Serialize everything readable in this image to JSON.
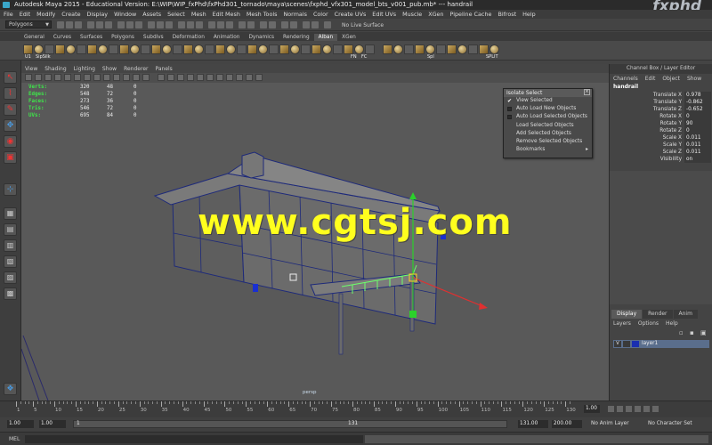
{
  "window": {
    "title": "Autodesk Maya 2015 - Educational Version: E:\\WIP\\WIP_fxPhd\\fxPhd301_tornado\\maya\\scenes\\fxphd_vfx301_model_bts_v001_pub.mb* --- handrail",
    "brand": "fxphd"
  },
  "menubar": [
    "File",
    "Edit",
    "Modify",
    "Create",
    "Display",
    "Window",
    "Assets",
    "Select",
    "Mesh",
    "Edit Mesh",
    "Mesh Tools",
    "Normals",
    "Color",
    "Create UVs",
    "Edit UVs",
    "Muscle",
    "XGen",
    "Pipeline Cache",
    "Bifrost",
    "Help"
  ],
  "statusline": {
    "mode": "Polygons",
    "live_surface": "No Live Surface"
  },
  "shelf": {
    "tabs": [
      "General",
      "Curves",
      "Surfaces",
      "Polygons",
      "Subdivs",
      "Deformation",
      "Animation",
      "Dynamics",
      "Rendering",
      "Alban",
      "XGen"
    ],
    "active_tab": "Alban",
    "labels": [
      "U1",
      "SipSilk",
      "FN",
      "FC",
      "Spl",
      "SPLIT"
    ]
  },
  "viewport": {
    "menu": [
      "View",
      "Shading",
      "Lighting",
      "Show",
      "Renderer",
      "Panels"
    ],
    "hud": [
      {
        "label": "Verts:",
        "a": "320",
        "b": "48",
        "c": "0"
      },
      {
        "label": "Edges:",
        "a": "548",
        "b": "72",
        "c": "0"
      },
      {
        "label": "Faces:",
        "a": "273",
        "b": "36",
        "c": "0"
      },
      {
        "label": "Tris:",
        "a": "546",
        "b": "72",
        "c": "0"
      },
      {
        "label": "UVs:",
        "a": "695",
        "b": "84",
        "c": "0"
      }
    ],
    "camera_label": "persp",
    "watermark": "www.cgtsj.com"
  },
  "isolate_select": {
    "title": "Isolate Select",
    "items": [
      {
        "label": "View Selected",
        "checked": true
      },
      {
        "label": "Auto Load New Objects",
        "checkbox": true
      },
      {
        "label": "Auto Load Selected Objects",
        "checkbox": true
      },
      {
        "label": "Load Selected Objects"
      },
      {
        "label": "Add Selected Objects"
      },
      {
        "label": "Remove Selected Objects"
      },
      {
        "label": "Bookmarks",
        "submenu": true
      }
    ]
  },
  "channel_box": {
    "title": "Channel Box / Layer Editor",
    "menu": [
      "Channels",
      "Edit",
      "Object",
      "Show"
    ],
    "object": "handrail",
    "attributes": [
      {
        "name": "Translate X",
        "value": "0.978"
      },
      {
        "name": "Translate Y",
        "value": "-0.862"
      },
      {
        "name": "Translate Z",
        "value": "-0.652"
      },
      {
        "name": "Rotate X",
        "value": "0"
      },
      {
        "name": "Rotate Y",
        "value": "90"
      },
      {
        "name": "Rotate Z",
        "value": "0"
      },
      {
        "name": "Scale X",
        "value": "0.011"
      },
      {
        "name": "Scale Y",
        "value": "0.011"
      },
      {
        "name": "Scale Z",
        "value": "0.011"
      },
      {
        "name": "Visibility",
        "value": "on"
      }
    ]
  },
  "layer_editor": {
    "tabs": [
      "Display",
      "Render",
      "Anim"
    ],
    "active_tab": "Display",
    "menu": [
      "Layers",
      "Options",
      "Help"
    ],
    "layers": [
      {
        "visible": "V",
        "name": "layer1",
        "color": "#1a2fb0"
      }
    ]
  },
  "timeline": {
    "ticks": [
      "1",
      "5",
      "10",
      "15",
      "20",
      "25",
      "30",
      "35",
      "40",
      "45",
      "50",
      "55",
      "60",
      "65",
      "70",
      "75",
      "80",
      "85",
      "90",
      "95",
      "100",
      "105",
      "110",
      "115",
      "120",
      "125",
      "130"
    ],
    "current_frame": "1.00"
  },
  "range": {
    "start": "1.00",
    "inner_start": "1.00",
    "slider_start": "1",
    "slider_end": "131",
    "inner_end": "131.00",
    "end": "200.00",
    "anim_layer": "No Anim Layer",
    "char_set": "No Character Set"
  },
  "command_line": {
    "label": "MEL"
  }
}
